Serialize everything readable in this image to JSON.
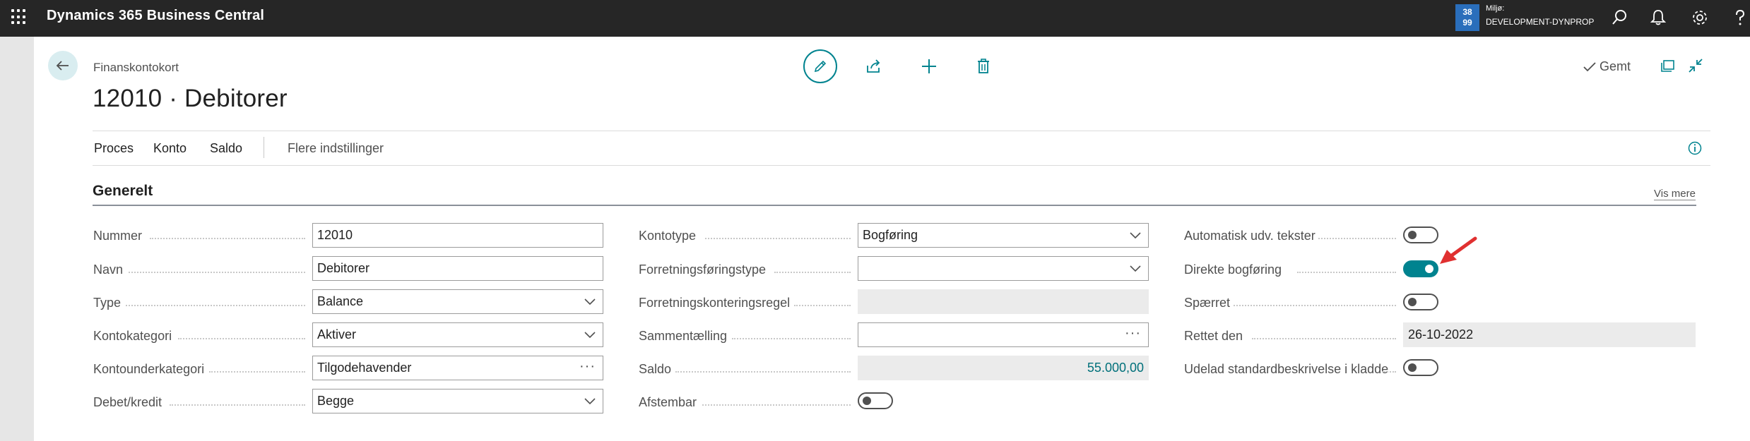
{
  "app": {
    "title": "Dynamics 365 Business Central",
    "environment_badge_line1": "38",
    "environment_badge_line2": "99",
    "environment_label": "Miljø:",
    "environment_name": "DEVELOPMENT-DYNPROP"
  },
  "page": {
    "breadcrumb": "Finanskontokort",
    "title": "12010 · Debitorer",
    "status": "Gemt"
  },
  "menu": {
    "items": [
      "Proces",
      "Konto",
      "Saldo"
    ],
    "more": "Flere indstillinger"
  },
  "section": {
    "title": "Generelt",
    "show_more": "Vis mere"
  },
  "fields": {
    "col1": [
      {
        "label": "Nummer",
        "value": "12010",
        "kind": "text"
      },
      {
        "label": "Navn",
        "value": "Debitorer",
        "kind": "text"
      },
      {
        "label": "Type",
        "value": "Balance",
        "kind": "select"
      },
      {
        "label": "Kontokategori",
        "value": "Aktiver",
        "kind": "select"
      },
      {
        "label": "Kontounderkategori",
        "value": "Tilgodehavender",
        "kind": "lookup"
      },
      {
        "label": "Debet/kredit",
        "value": "Begge",
        "kind": "select"
      }
    ],
    "col2": [
      {
        "label": "Kontotype",
        "value": "Bogføring",
        "kind": "select"
      },
      {
        "label": "Forretningsføringstype",
        "value": "",
        "kind": "select"
      },
      {
        "label": "Forretningskonteringsregel",
        "value": "",
        "kind": "readonly"
      },
      {
        "label": "Sammentælling",
        "value": "",
        "kind": "lookup"
      },
      {
        "label": "Saldo",
        "value": "55.000,00",
        "kind": "readonly-number"
      },
      {
        "label": "Afstembar",
        "value": false,
        "kind": "toggle"
      }
    ],
    "col3": [
      {
        "label": "Automatisk udv. tekster",
        "value": false,
        "kind": "toggle"
      },
      {
        "label": "Direkte bogføring",
        "value": true,
        "kind": "toggle"
      },
      {
        "label": "Spærret",
        "value": false,
        "kind": "toggle"
      },
      {
        "label": "Rettet den",
        "value": "26-10-2022",
        "kind": "readonly"
      },
      {
        "label": "Udelad standardbeskrivelse i kladde",
        "value": false,
        "kind": "toggle"
      }
    ]
  },
  "colors": {
    "accent": "#00838f",
    "topbar": "#262626",
    "env_badge": "#2a6ebb",
    "annotation_arrow": "#e03030"
  },
  "icons": [
    "waffle-icon",
    "search-icon",
    "bell-icon",
    "gear-icon",
    "help-icon",
    "back-arrow-icon",
    "pencil-icon",
    "share-icon",
    "plus-icon",
    "trash-icon",
    "check-icon",
    "pop-out-icon",
    "collapse-icon",
    "info-icon",
    "chevron-down-icon"
  ]
}
